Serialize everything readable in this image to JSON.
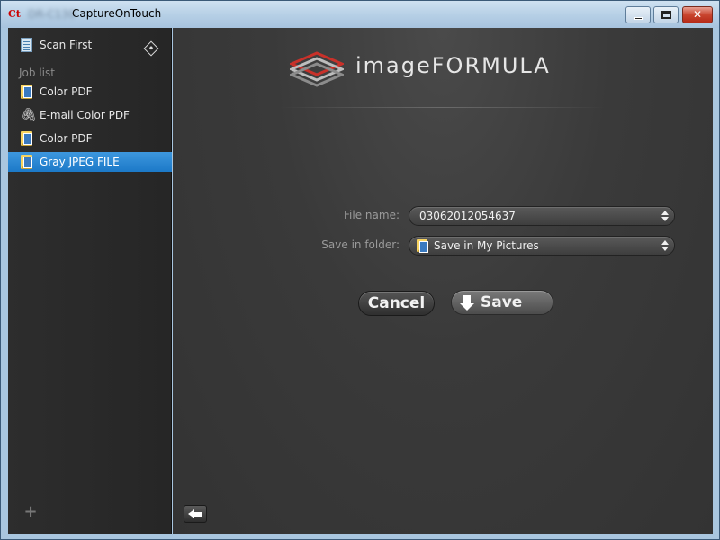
{
  "window": {
    "app_icon": "Ct",
    "device_name": "DR-C130",
    "title": "CaptureOnTouch",
    "controls": [
      "minimize-icon",
      "maximize-icon",
      "close-icon"
    ],
    "close_glyph": "✕"
  },
  "sidebar": {
    "scan_first": {
      "label": "Scan First",
      "icon": "document-icon",
      "action_icon": "diamond-arrow-icon"
    },
    "job_list_label": "Job list",
    "jobs": [
      {
        "label": "Color PDF",
        "icon": "folder-icon",
        "selected": false
      },
      {
        "label": "E-mail Color PDF",
        "icon": "paperclip-icon",
        "selected": false
      },
      {
        "label": "Color PDF",
        "icon": "folder-icon",
        "selected": false
      },
      {
        "label": "Gray JPEG FILE",
        "icon": "folder-icon",
        "selected": true
      }
    ],
    "add_glyph": "+",
    "paperclip_glyph": "🖇"
  },
  "main": {
    "logo_text": "imageFORMULA",
    "form": {
      "file_name_label": "File name:",
      "file_name_value": "03062012054637",
      "save_folder_label": "Save in folder:",
      "save_folder_value": "Save in My Pictures"
    },
    "buttons": {
      "cancel": "Cancel",
      "save": "Save"
    }
  },
  "colors": {
    "selection": "#1c79c8",
    "sidebar_bg": "#2a2a2a",
    "main_bg": "#3a3a3a",
    "logo_accent": "#c8312a"
  }
}
